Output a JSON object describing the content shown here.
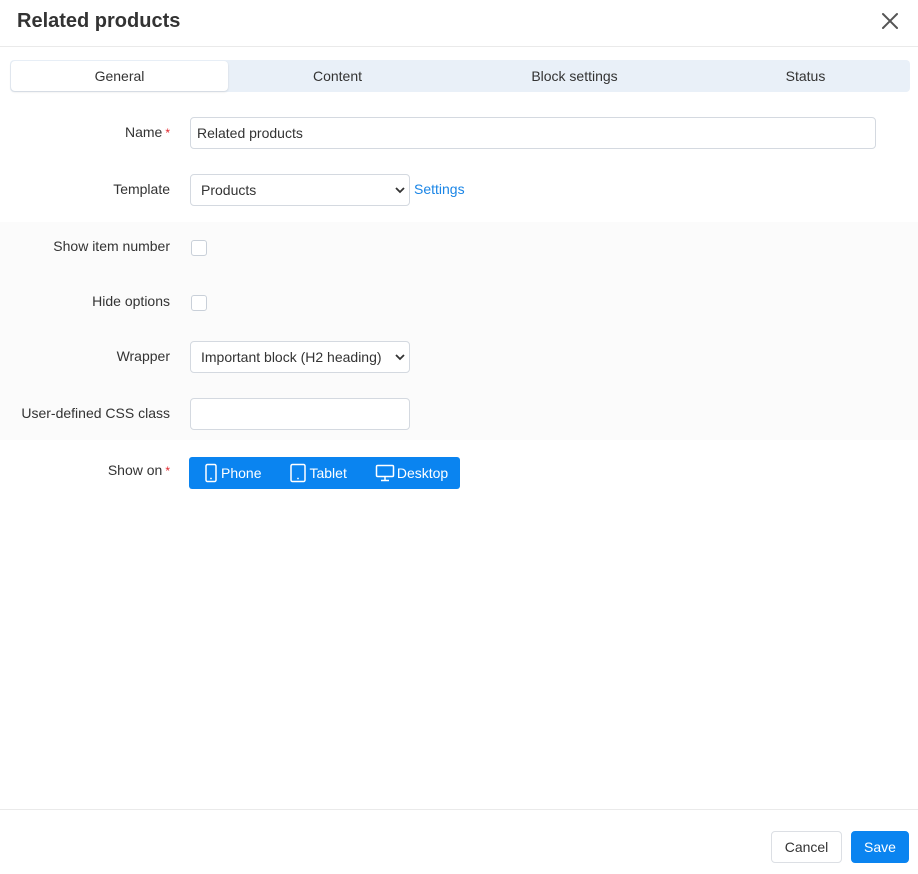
{
  "dialog": {
    "title": "Related products"
  },
  "tabs": [
    {
      "label": "General",
      "active": true
    },
    {
      "label": "Content",
      "active": false
    },
    {
      "label": "Block settings",
      "active": false
    },
    {
      "label": "Status",
      "active": false
    }
  ],
  "form": {
    "name": {
      "label": "Name",
      "required_mark": "*",
      "value": "Related products"
    },
    "template": {
      "label": "Template",
      "selected": "Products",
      "settings_link": "Settings"
    },
    "show_item_number": {
      "label": "Show item number",
      "checked": false
    },
    "hide_options": {
      "label": "Hide options",
      "checked": false
    },
    "wrapper": {
      "label": "Wrapper",
      "selected": "Important block (H2 heading)"
    },
    "css_class": {
      "label": "User-defined CSS class",
      "value": ""
    },
    "show_on": {
      "label": "Show on",
      "required_mark": "*",
      "devices": [
        {
          "label": "Phone",
          "icon": "phone-icon",
          "selected": true
        },
        {
          "label": "Tablet",
          "icon": "tablet-icon",
          "selected": true
        },
        {
          "label": "Desktop",
          "icon": "desktop-icon",
          "selected": true
        }
      ]
    }
  },
  "footer": {
    "cancel_label": "Cancel",
    "save_label": "Save"
  },
  "colors": {
    "accent": "#0a84f0",
    "required": "#e0262c",
    "link": "#1a85e6",
    "tabs_bg": "#e9f0f8"
  }
}
